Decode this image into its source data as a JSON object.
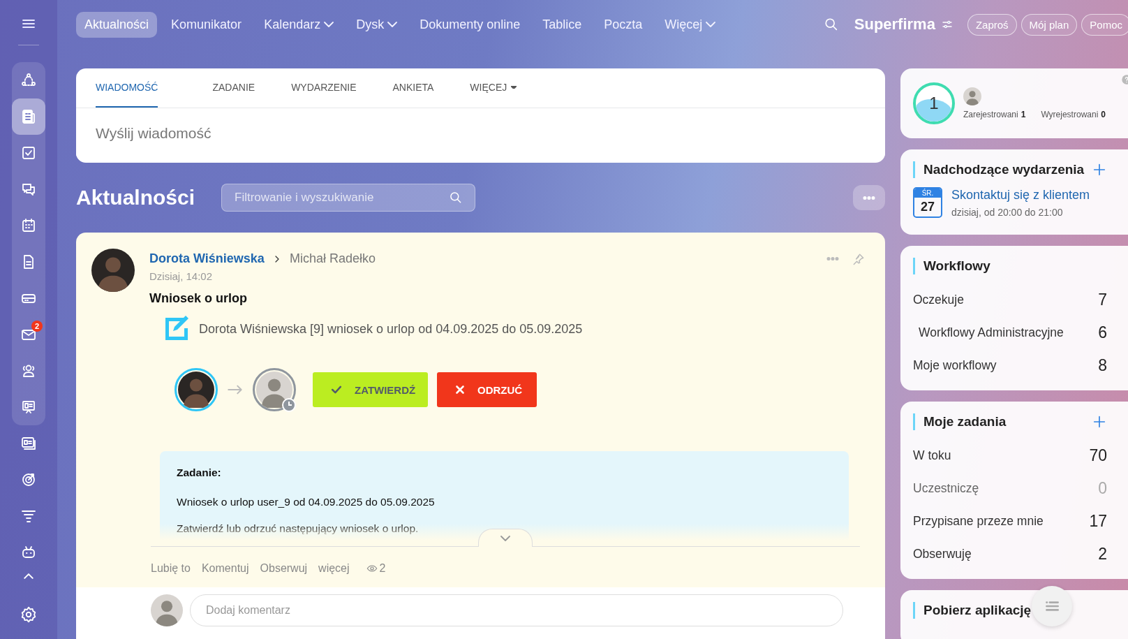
{
  "topnav": {
    "items": [
      {
        "label": "Aktualności",
        "selected": true,
        "dropdown": false
      },
      {
        "label": "Komunikator",
        "selected": false,
        "dropdown": false
      },
      {
        "label": "Kalendarz",
        "selected": false,
        "dropdown": true
      },
      {
        "label": "Dysk",
        "selected": false,
        "dropdown": true
      },
      {
        "label": "Dokumenty online",
        "selected": false,
        "dropdown": false
      },
      {
        "label": "Tablice",
        "selected": false,
        "dropdown": false
      },
      {
        "label": "Poczta",
        "selected": false,
        "dropdown": false
      },
      {
        "label": "Więcej",
        "selected": false,
        "dropdown": true
      }
    ],
    "brand": "Superfirma",
    "buttons": [
      "Zaproś",
      "Mój plan",
      "Pomoc"
    ]
  },
  "sidebar": {
    "items": [
      {
        "selected": false
      },
      {
        "selected": true
      },
      {
        "selected": false
      },
      {
        "selected": false
      },
      {
        "selected": false
      },
      {
        "selected": false
      },
      {
        "selected": false
      },
      {
        "selected": false,
        "badge": "2"
      },
      {
        "selected": false
      },
      {
        "selected": false
      },
      {
        "selected": false
      },
      {
        "selected": false
      },
      {
        "selected": false
      },
      {
        "selected": false
      }
    ]
  },
  "composer": {
    "tabs": [
      {
        "label": "WIADOMOŚĆ",
        "selected": true,
        "dropdown": false
      },
      {
        "label": "ZADANIE",
        "selected": false,
        "dropdown": false
      },
      {
        "label": "WYDARZENIE",
        "selected": false,
        "dropdown": false
      },
      {
        "label": "ANKIETA",
        "selected": false,
        "dropdown": false
      },
      {
        "label": "WIĘCEJ",
        "selected": false,
        "dropdown": true
      }
    ],
    "placeholder": "Wyślij wiadomość"
  },
  "feed": {
    "title": "Aktualności",
    "filter_placeholder": "Filtrowanie i wyszukiwanie"
  },
  "post": {
    "author": "Dorota Wiśniewska",
    "recipient": "Michał Radełko",
    "time": "Dzisiaj, 14:02",
    "title": "Wniosek o urlop",
    "workflow_text": "Dorota Wiśniewska [9] wniosek o urlop od 04.09.2025 do 05.09.2025",
    "approve": "ZATWIERDŹ",
    "reject": "ODRZUĆ",
    "task": {
      "heading": "Zadanie:",
      "lines": [
        "Wniosek o urlop user_9 od 04.09.2025 do 05.09.2025",
        "Zatwierdź lub odrzuć następujący wniosek o urlop."
      ]
    },
    "actions": [
      "Lubię to",
      "Komentuj",
      "Obserwuj",
      "więcej"
    ],
    "views": "2",
    "comment_placeholder": "Dodaj komentarz"
  },
  "attendance": {
    "count": "1",
    "registered_label": "Zarejestrowani",
    "registered": "1",
    "unregistered_label": "Wyrejestrowani",
    "unregistered": "0"
  },
  "events": {
    "title": "Nadchodzące wydarzenia",
    "items": [
      {
        "weekday": "ŚR.",
        "day": "27",
        "title": "Skontaktuj się z klientem",
        "time": "dzisiaj, od 20:00 do 21:00"
      }
    ]
  },
  "workflows": {
    "title": "Workflowy",
    "rows": [
      {
        "label": "Oczekuje",
        "count": "7",
        "children": [
          {
            "label": "Workflowy Administracyjne",
            "count": "6"
          }
        ]
      },
      {
        "label": "Moje workflowy",
        "count": "8"
      }
    ]
  },
  "tasks": {
    "title": "Moje zadania",
    "rows": [
      {
        "label": "W toku",
        "count": "70",
        "muted": false
      },
      {
        "label": "Uczestniczę",
        "count": "0",
        "muted": true
      },
      {
        "label": "Przypisane przeze mnie",
        "count": "17",
        "muted": false
      },
      {
        "label": "Obserwuję",
        "count": "2",
        "muted": false
      }
    ]
  },
  "apps": {
    "title": "Pobierz aplikację"
  }
}
